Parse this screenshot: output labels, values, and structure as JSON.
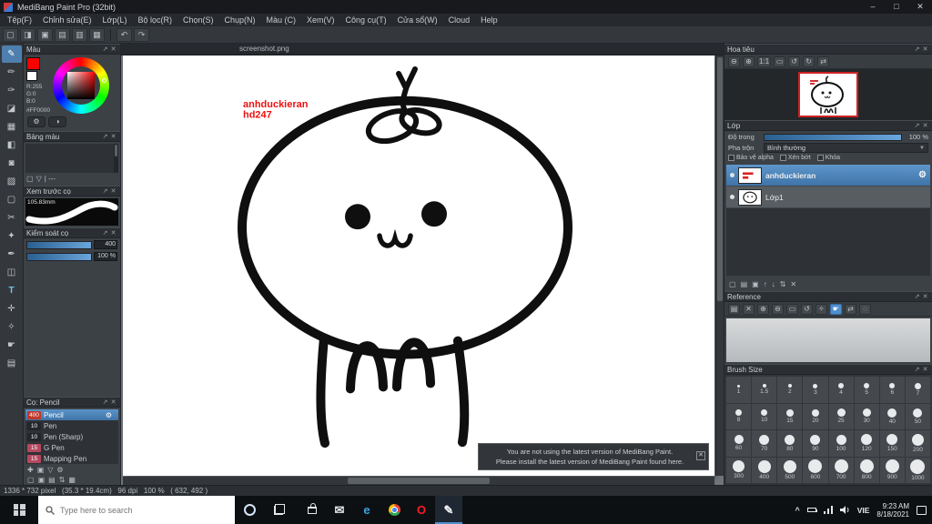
{
  "ui": {
    "float_glyph": "↗",
    "close_glyph": "✕"
  },
  "window": {
    "title": "MediBang Paint Pro (32bit)",
    "controls": {
      "minimize": "–",
      "maximize": "□",
      "close": "✕"
    }
  },
  "menubar": {
    "items": [
      {
        "id": "file",
        "label": "Tệp(F)"
      },
      {
        "id": "edit",
        "label": "Chỉnh sửa(E)"
      },
      {
        "id": "layer",
        "label": "Lớp(L)"
      },
      {
        "id": "filter",
        "label": "Bộ lọc(R)"
      },
      {
        "id": "select",
        "label": "Chọn(S)"
      },
      {
        "id": "snap",
        "label": "Chụp(N)"
      },
      {
        "id": "color",
        "label": "Màu (C)"
      },
      {
        "id": "view",
        "label": "Xem(V)"
      },
      {
        "id": "tools",
        "label": "Công cụ(T)"
      },
      {
        "id": "window",
        "label": "Cửa sổ(W)"
      },
      {
        "id": "cloud",
        "label": "Cloud"
      },
      {
        "id": "help",
        "label": "Help"
      }
    ]
  },
  "toolbar": {
    "icons": [
      {
        "name": "new-file",
        "glyph": "▢"
      },
      {
        "name": "open-file",
        "glyph": "◨"
      },
      {
        "name": "save-file",
        "glyph": "▣"
      },
      {
        "name": "export-file",
        "glyph": "▤"
      },
      {
        "name": "print",
        "glyph": "▥"
      },
      {
        "name": "settings-grid",
        "glyph": "▦"
      },
      {
        "divider": true
      },
      {
        "name": "undo",
        "glyph": "↶"
      },
      {
        "name": "redo",
        "glyph": "↷"
      }
    ]
  },
  "tools": [
    {
      "name": "brush",
      "glyph": "✎",
      "selected": true
    },
    {
      "name": "pencil",
      "glyph": "✏"
    },
    {
      "name": "airbrush",
      "glyph": "✑"
    },
    {
      "name": "eraser",
      "glyph": "◪"
    },
    {
      "name": "dot",
      "glyph": "▦"
    },
    {
      "name": "fill",
      "glyph": "◧"
    },
    {
      "name": "bucket",
      "glyph": "◙"
    },
    {
      "name": "gradient",
      "glyph": "▨"
    },
    {
      "name": "select",
      "glyph": "▢"
    },
    {
      "name": "lasso",
      "glyph": "✂"
    },
    {
      "name": "magic-wand",
      "glyph": "✦"
    },
    {
      "name": "select-pen",
      "glyph": "✒"
    },
    {
      "name": "select-eraser",
      "glyph": "◫"
    },
    {
      "name": "text",
      "glyph": "T",
      "accent": true
    },
    {
      "name": "move",
      "glyph": "✛"
    },
    {
      "name": "eyedropper",
      "glyph": "✧"
    },
    {
      "name": "hand",
      "glyph": "☛"
    },
    {
      "name": "divide",
      "glyph": "▤"
    }
  ],
  "color_panel": {
    "title": "Màu",
    "r": "R:255",
    "g": "G:0",
    "b": "B:0",
    "hex": "#FF0000",
    "buttons": [
      {
        "name": "color-settings",
        "glyph": "⚙"
      },
      {
        "name": "color-picker",
        "glyph": "◑"
      }
    ]
  },
  "palette_panel": {
    "title": "Bảng màu",
    "label": "| ---",
    "icons": [
      {
        "name": "add-color",
        "glyph": "▢"
      },
      {
        "name": "delete-color",
        "glyph": "▽"
      }
    ]
  },
  "preview_panel": {
    "title": "Xem trước cọ",
    "size": "105.83mm"
  },
  "control_panel": {
    "title": "Kiểm soát cọ",
    "rows": [
      {
        "value": "400"
      },
      {
        "value": "100 %"
      }
    ]
  },
  "brush_panel": {
    "title": "Cọ: Pencil",
    "brushes": [
      {
        "id": "pencil",
        "size": "400",
        "name": "Pencil",
        "chip": "#c0392b",
        "selected": true
      },
      {
        "id": "pen",
        "size": "10",
        "name": "Pen",
        "chip": "#23272b"
      },
      {
        "id": "pen-sharp",
        "size": "10",
        "name": "Pen (Sharp)",
        "chip": "#23272b"
      },
      {
        "id": "g-pen",
        "size": "15",
        "name": "G Pen",
        "chip": "#b5485e"
      },
      {
        "id": "mapping-pen",
        "size": "15",
        "name": "Mapping Pen",
        "chip": "#b5485e"
      }
    ],
    "footer_icons_1": [
      {
        "name": "add-brush",
        "glyph": "✚"
      },
      {
        "name": "duplicate-brush",
        "glyph": "▣"
      },
      {
        "name": "delete-brush",
        "glyph": "▽"
      },
      {
        "name": "brush-settings",
        "glyph": "⚙"
      }
    ],
    "footer_icons_2": [
      {
        "name": "new-page",
        "glyph": "▢"
      },
      {
        "name": "copy-page",
        "glyph": "▣"
      },
      {
        "name": "page-list",
        "glyph": "▤"
      },
      {
        "name": "transfer",
        "glyph": "⇅"
      },
      {
        "name": "grid",
        "glyph": "▦"
      }
    ]
  },
  "canvas": {
    "tab": "screenshot.png",
    "watermark": [
      "anhduckieran",
      "hd247"
    ]
  },
  "toast": {
    "line1": "You are not using the latest version of MediBang Paint.",
    "line2": "Please install the latest version of MediBang Paint found here.",
    "close": "✕"
  },
  "navigator": {
    "title": "Hoa tiêu",
    "icons": [
      {
        "name": "zoom-out",
        "glyph": "⊖"
      },
      {
        "name": "zoom-in",
        "glyph": "⊕"
      },
      {
        "name": "actual-size",
        "glyph": "1:1"
      },
      {
        "name": "fit-window",
        "glyph": "▭"
      },
      {
        "name": "rotate-left",
        "glyph": "↺"
      },
      {
        "name": "rotate-right",
        "glyph": "↻"
      },
      {
        "name": "flip",
        "glyph": "⇄"
      }
    ]
  },
  "layers": {
    "title": "Lớp",
    "opacity_label": "Độ trong",
    "opacity_value": "100 %",
    "blend_label": "Pha trộn",
    "blend_value": "Bình thường",
    "checks": [
      "Bảo vệ alpha",
      "Xén bớt",
      "Khóa"
    ],
    "items": [
      {
        "name": "anhduckieran",
        "selected": true
      },
      {
        "name": "Lớp1"
      }
    ],
    "footer_icons": [
      {
        "name": "new-layer",
        "glyph": "▢"
      },
      {
        "name": "new-folder",
        "glyph": "▤"
      },
      {
        "name": "duplicate-layer",
        "glyph": "▣"
      },
      {
        "name": "move-layer-up",
        "glyph": "↑"
      },
      {
        "name": "move-layer-down",
        "glyph": "↓"
      },
      {
        "name": "merge-layer",
        "glyph": "⇅"
      },
      {
        "name": "delete-layer",
        "glyph": "✕"
      }
    ]
  },
  "reference": {
    "title": "Reference",
    "icons": [
      {
        "name": "open-reference",
        "glyph": "▤"
      },
      {
        "name": "close-reference",
        "glyph": "✕"
      },
      {
        "name": "zoom-in",
        "glyph": "⊕"
      },
      {
        "name": "zoom-out",
        "glyph": "⊖"
      },
      {
        "name": "fit",
        "glyph": "▭"
      },
      {
        "name": "rotate",
        "glyph": "↺"
      },
      {
        "name": "eyedropper",
        "glyph": "✧"
      },
      {
        "name": "hand",
        "glyph": "☛",
        "accent": true
      },
      {
        "name": "flip",
        "glyph": "⇄"
      },
      {
        "name": "clear",
        "glyph": "◌"
      }
    ]
  },
  "brush_size": {
    "title": "Brush Size",
    "rows": [
      [
        1,
        1.5,
        2,
        3,
        4,
        5,
        6,
        7
      ],
      [
        8,
        10,
        15,
        20,
        25,
        30,
        40,
        50
      ],
      [
        60,
        70,
        80,
        90,
        100,
        120,
        150,
        200
      ],
      [
        300,
        400,
        500,
        600,
        700,
        800,
        900,
        1000
      ]
    ]
  },
  "statusbar": {
    "text": "1336 * 732 pixel   (35.3 * 19.4cm)   96 dpi   100 %   ( 632, 492 )"
  },
  "taskbar": {
    "search_placeholder": "Type here to search",
    "pins": [
      {
        "id": "store",
        "shape": "store"
      },
      {
        "id": "mail",
        "glyph": "✉",
        "color": "#e6e8ea"
      },
      {
        "id": "edge",
        "glyph": "e",
        "color": "#3aa3e3"
      },
      {
        "id": "chrome",
        "shape": "chrome"
      },
      {
        "id": "opera",
        "glyph": "O",
        "color": "#ff1b2d"
      },
      {
        "id": "medibang",
        "glyph": "✎",
        "color": "#f2f4f6",
        "active": true
      }
    ],
    "lang": "VIE",
    "time": "9:23 AM",
    "date": "8/18/2021"
  }
}
